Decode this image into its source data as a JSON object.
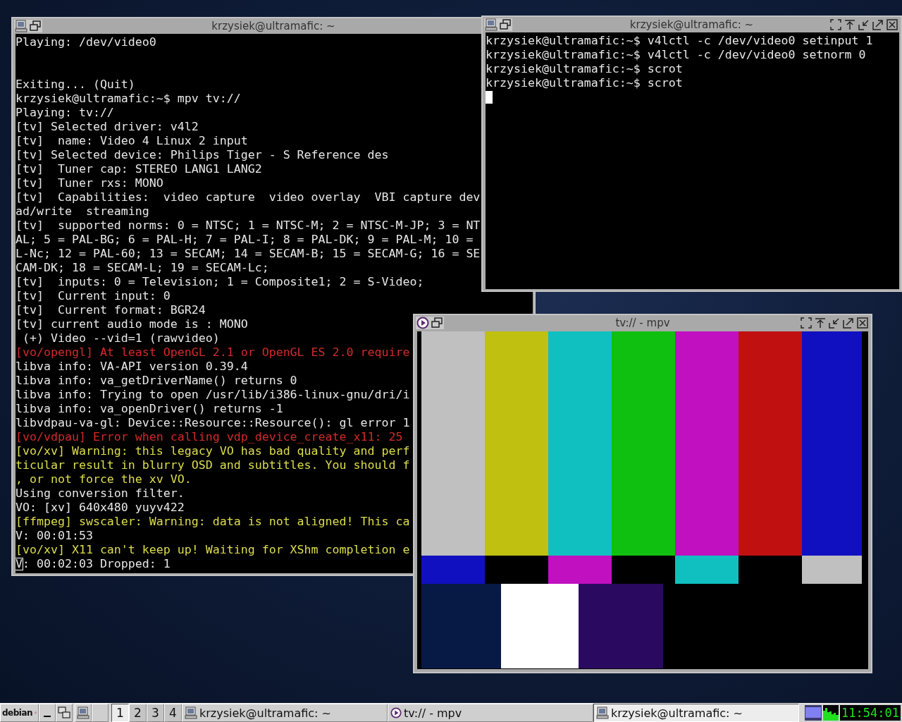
{
  "left_terminal": {
    "title": "krzysiek@ultramafic: ~",
    "lines": [
      {
        "kind": "plain",
        "text": "Playing: /dev/video0"
      },
      {
        "kind": "blank"
      },
      {
        "kind": "blank"
      },
      {
        "kind": "plain",
        "text": "Exiting... (Quit)"
      },
      {
        "kind": "plain",
        "text": "krzysiek@ultramafic:~$ mpv tv://"
      },
      {
        "kind": "plain",
        "text": "Playing: tv://"
      },
      {
        "kind": "plain",
        "text": "[tv] Selected driver: v4l2"
      },
      {
        "kind": "plain",
        "text": "[tv]  name: Video 4 Linux 2 input"
      },
      {
        "kind": "plain",
        "text": "[tv] Selected device: Philips Tiger - S Reference des"
      },
      {
        "kind": "plain",
        "text": "[tv]  Tuner cap: STEREO LANG1 LANG2"
      },
      {
        "kind": "plain",
        "text": "[tv]  Tuner rxs: MONO"
      },
      {
        "kind": "plain",
        "text": "[tv]  Capabilities:  video capture  video overlay  VBI capture dev"
      },
      {
        "kind": "plain",
        "text": "ad/write  streaming"
      },
      {
        "kind": "plain",
        "text": "[tv]  supported norms: 0 = NTSC; 1 = NTSC-M; 2 = NTSC-M-JP; 3 = NT"
      },
      {
        "kind": "plain",
        "text": "AL; 5 = PAL-BG; 6 = PAL-H; 7 = PAL-I; 8 = PAL-DK; 9 = PAL-M; 10 ="
      },
      {
        "kind": "plain",
        "text": "L-Nc; 12 = PAL-60; 13 = SECAM; 14 = SECAM-B; 15 = SECAM-G; 16 = SE"
      },
      {
        "kind": "plain",
        "text": "CAM-DK; 18 = SECAM-L; 19 = SECAM-Lc;"
      },
      {
        "kind": "plain",
        "text": "[tv]  inputs: 0 = Television; 1 = Composite1; 2 = S-Video;"
      },
      {
        "kind": "plain",
        "text": "[tv]  Current input: 0"
      },
      {
        "kind": "plain",
        "text": "[tv]  Current format: BGR24"
      },
      {
        "kind": "plain",
        "text": "[tv] current audio mode is : MONO"
      },
      {
        "kind": "plain",
        "text": " (+) Video --vid=1 (rawvideo)"
      },
      {
        "kind": "error",
        "text": "[vo/opengl] At least OpenGL 2.1 or OpenGL ES 2.0 require"
      },
      {
        "kind": "plain",
        "text": "libva info: VA-API version 0.39.4"
      },
      {
        "kind": "plain",
        "text": "libva info: va_getDriverName() returns 0"
      },
      {
        "kind": "plain",
        "text": "libva info: Trying to open /usr/lib/i386-linux-gnu/dri/i"
      },
      {
        "kind": "plain",
        "text": "libva info: va_openDriver() returns -1"
      },
      {
        "kind": "plain",
        "text": "libvdpau-va-gl: Device::Resource::Resource(): gl error 1"
      },
      {
        "kind": "error",
        "text": "[vo/vdpau] Error when calling vdp_device_create_x11: 25"
      },
      {
        "kind": "warning",
        "text": "[vo/xv] Warning: this legacy VO has bad quality and perf"
      },
      {
        "kind": "warning",
        "text": "ticular result in blurry OSD and subtitles. You should f"
      },
      {
        "kind": "warning",
        "text": ", or not force the xv VO."
      },
      {
        "kind": "plain",
        "text": "Using conversion filter."
      },
      {
        "kind": "plain",
        "text": "VO: [xv] 640x480 yuyv422"
      },
      {
        "kind": "warning",
        "text": "[ffmpeg] swscaler: Warning: data is not aligned! This ca"
      },
      {
        "kind": "plain",
        "text": "V: 00:01:53"
      },
      {
        "kind": "warning",
        "text": "[vo/xv] X11 can't keep up! Waiting for XShm completion e"
      },
      {
        "kind": "plain",
        "text": "V: 00:02:03 Dropped: 1",
        "cursor": true
      }
    ]
  },
  "right_terminal": {
    "title": "krzysiek@ultramafic: ~",
    "lines": [
      {
        "kind": "plain",
        "text": "krzysiek@ultramafic:~$ v4lctl -c /dev/video0 setinput 1"
      },
      {
        "kind": "plain",
        "text": "krzysiek@ultramafic:~$ v4lctl -c /dev/video0 setnorm 0"
      },
      {
        "kind": "plain",
        "text": "krzysiek@ultramafic:~$ scrot"
      },
      {
        "kind": "plain",
        "text": "krzysiek@ultramafic:~$ scrot"
      },
      {
        "kind": "blank",
        "cursor": true
      }
    ]
  },
  "mpv_window": {
    "title": "tv:// - mpv"
  },
  "taskbar": {
    "start_label": "debian",
    "desktops": [
      {
        "label": "1",
        "selected": true
      },
      {
        "label": "2",
        "selected": false
      },
      {
        "label": "3",
        "selected": false
      },
      {
        "label": "4",
        "selected": false
      }
    ],
    "tasks": [
      {
        "kind": "terminal",
        "title": "krzysiek@ultramafic: ~",
        "selected": false
      },
      {
        "kind": "mpv",
        "title": "tv:// - mpv",
        "selected": false
      },
      {
        "kind": "terminal",
        "title": "krzysiek@ultramafic: ~",
        "selected": true
      }
    ],
    "clock": "11:54:01"
  }
}
